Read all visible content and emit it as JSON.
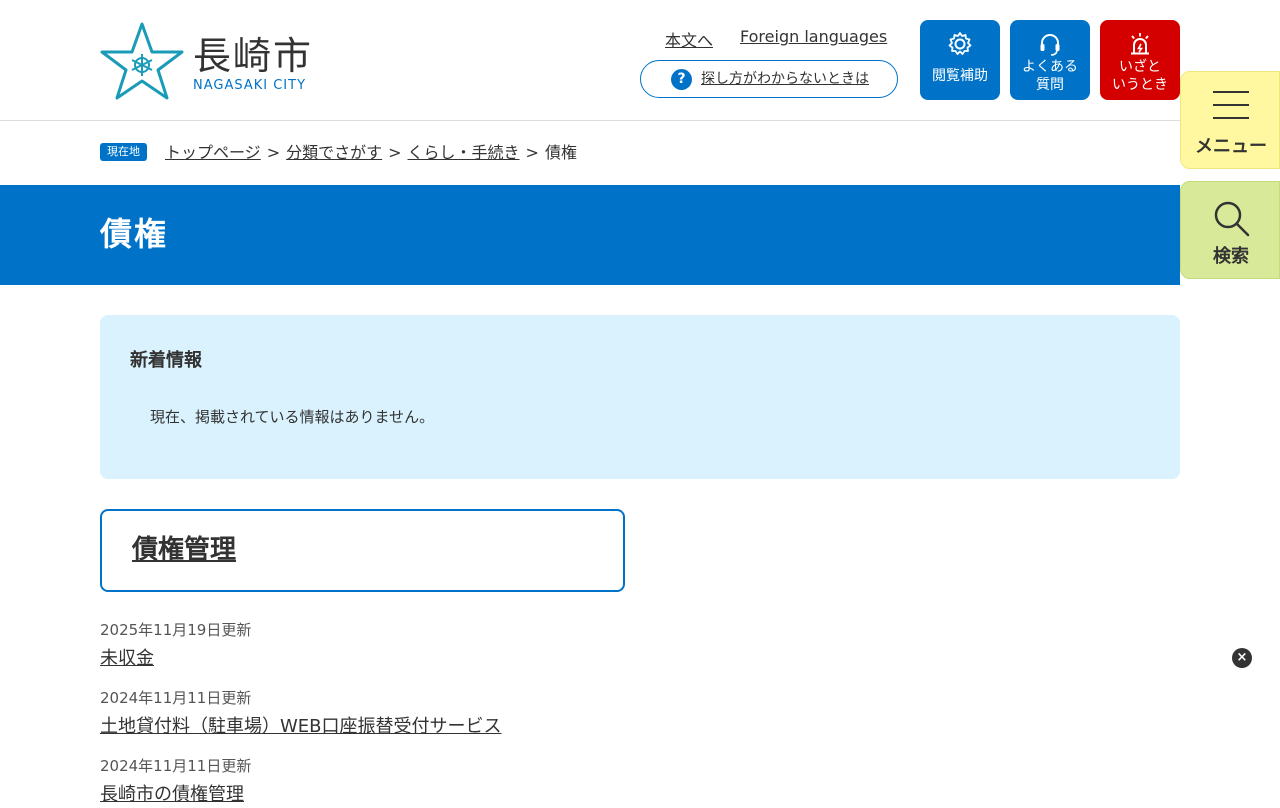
{
  "header": {
    "logo_text": "長崎市",
    "logo_sub": "NAGASAKI CITY",
    "skip_link": "本文へ",
    "foreign_link": "Foreign languages",
    "help_label": "探し方がわからないときは",
    "help_icon_char": "?",
    "buttons": [
      {
        "line1": "閲覧補助",
        "line2": "",
        "icon": "gear-icon"
      },
      {
        "line1": "よくある",
        "line2": "質問",
        "icon": "headset-icon"
      },
      {
        "line1": "いざと",
        "line2": "いうとき",
        "icon": "alarm-light-icon"
      }
    ]
  },
  "side": {
    "menu_label": "メニュー",
    "search_label": "検索"
  },
  "breadcrumb": {
    "badge": "現在地",
    "items": [
      "トップページ",
      "分類でさがす",
      "くらし・手続き"
    ],
    "separator": ">",
    "current": "債権"
  },
  "page_title": "債権",
  "news": {
    "heading": "新着情報",
    "message": "現在、掲載されている情報はありません。"
  },
  "category": {
    "title": "債権管理"
  },
  "items": [
    {
      "date": "2025年11月19日更新",
      "title": "未収金"
    },
    {
      "date": "2024年11月11日更新",
      "title": "土地貸付料（駐車場）WEB口座振替受付サービス"
    },
    {
      "date": "2024年11月11日更新",
      "title": "長崎市の債権管理"
    }
  ],
  "close_char": "×",
  "colors": {
    "primary": "#0073c8",
    "emergency": "#d40000",
    "menu_bg": "#fff8a0",
    "search_bg": "#d8ea9a",
    "news_bg": "#d9f2fd"
  }
}
